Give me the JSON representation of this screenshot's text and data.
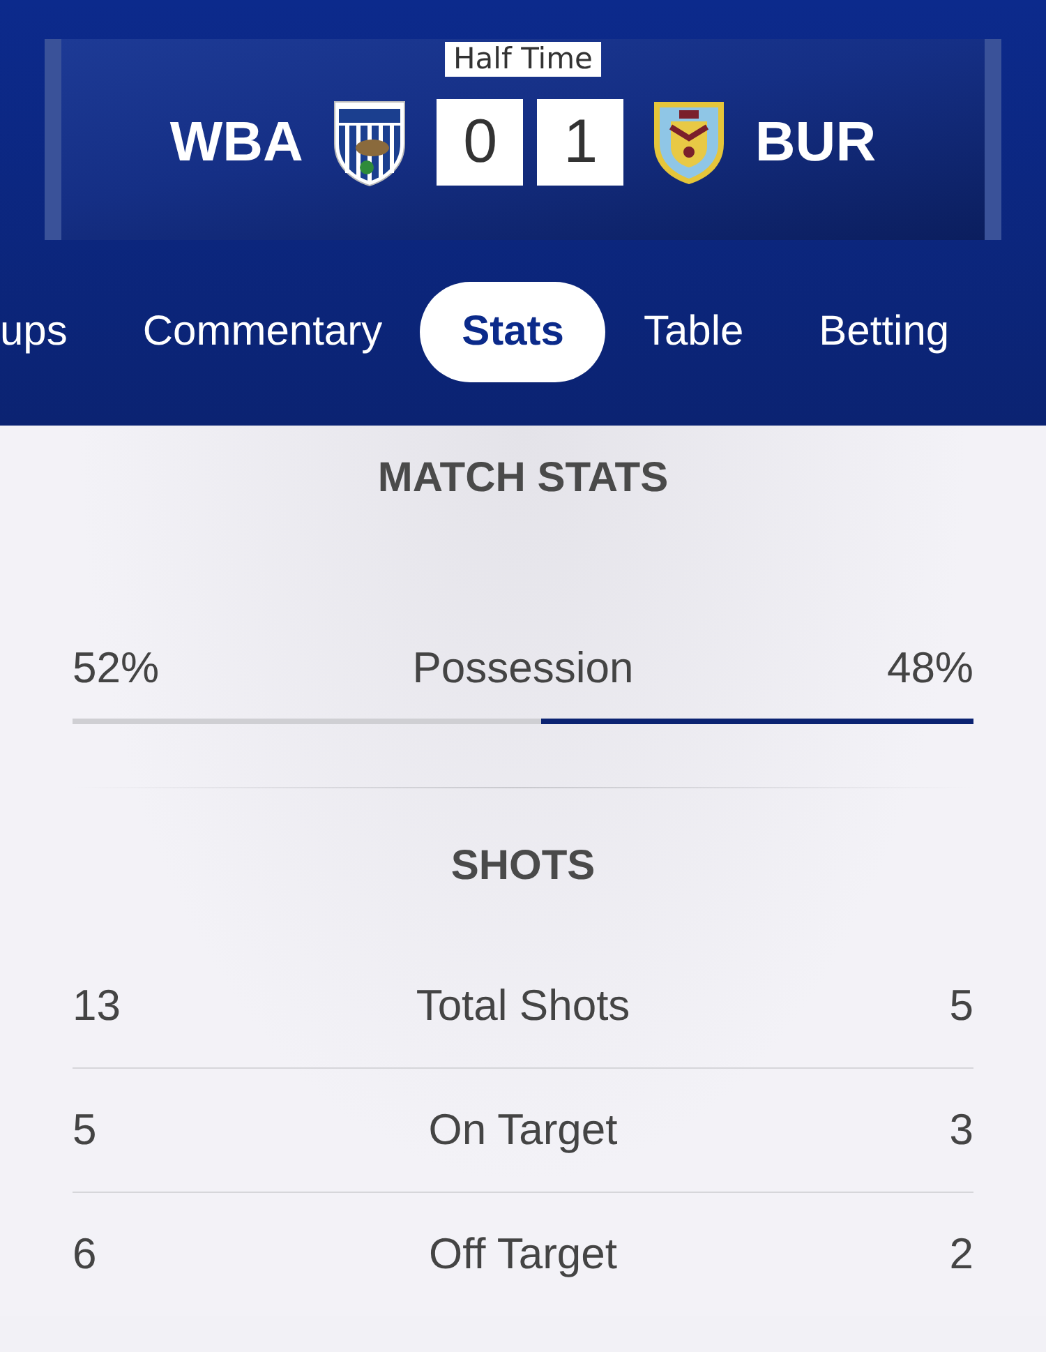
{
  "scoreboard": {
    "status": "Half Time",
    "home": {
      "name": "WBA",
      "score": "0"
    },
    "away": {
      "name": "BUR",
      "score": "1"
    }
  },
  "tabs": [
    {
      "label": "ups",
      "selected": false
    },
    {
      "label": "Commentary",
      "selected": false
    },
    {
      "label": "Stats",
      "selected": true
    },
    {
      "label": "Table",
      "selected": false
    },
    {
      "label": "Betting",
      "selected": false
    }
  ],
  "match_stats": {
    "heading": "MATCH STATS",
    "possession": {
      "home": "52%",
      "label": "Possession",
      "away": "48%",
      "level": 0.52
    }
  },
  "shots": {
    "heading": "SHOTS",
    "rows": [
      {
        "home": "13",
        "label": "Total Shots",
        "away": "5"
      },
      {
        "home": "5",
        "label": "On Target",
        "away": "3"
      },
      {
        "home": "6",
        "label": "Off Target",
        "away": "2"
      }
    ]
  }
}
